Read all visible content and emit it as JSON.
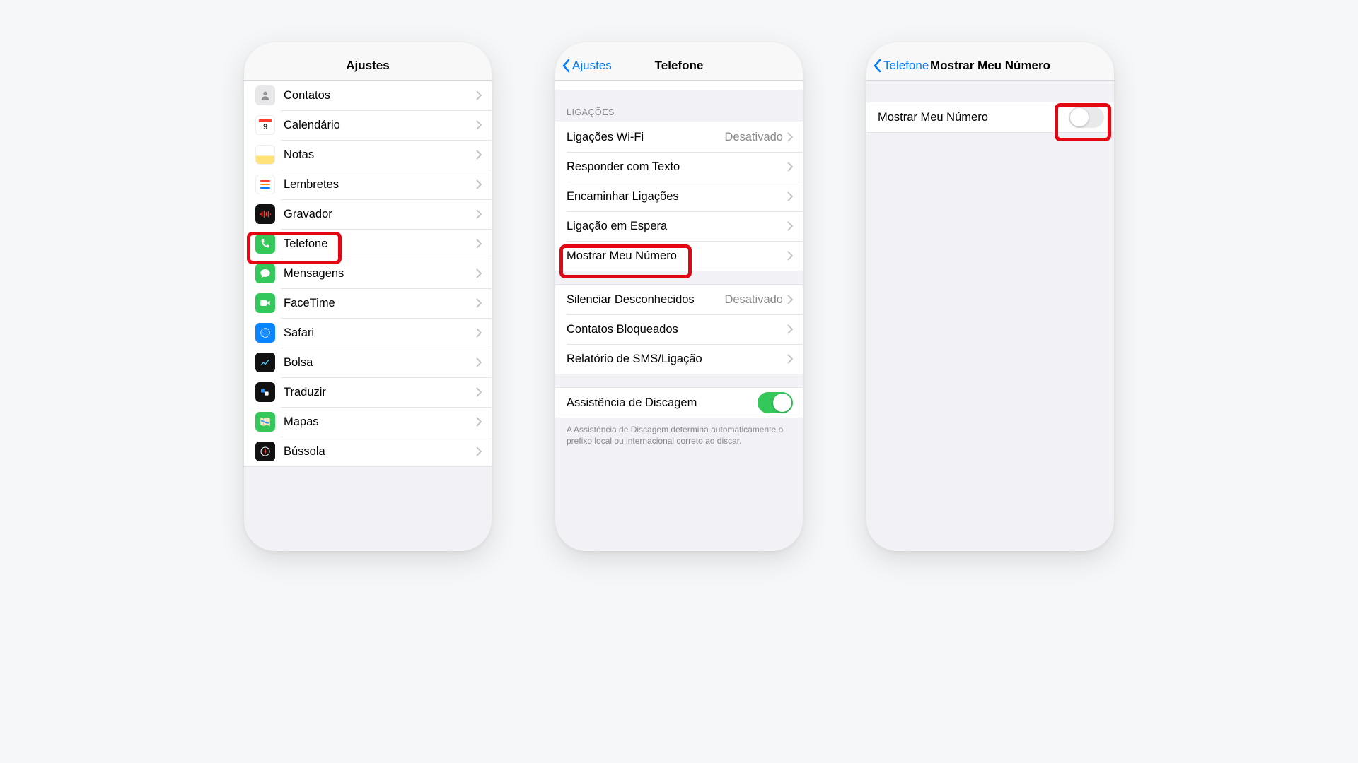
{
  "screens": {
    "settings": {
      "title": "Ajustes",
      "items": [
        {
          "label": "Contatos"
        },
        {
          "label": "Calendário"
        },
        {
          "label": "Notas"
        },
        {
          "label": "Lembretes"
        },
        {
          "label": "Gravador"
        },
        {
          "label": "Telefone"
        },
        {
          "label": "Mensagens"
        },
        {
          "label": "FaceTime"
        },
        {
          "label": "Safari"
        },
        {
          "label": "Bolsa"
        },
        {
          "label": "Traduzir"
        },
        {
          "label": "Mapas"
        },
        {
          "label": "Bússola"
        }
      ]
    },
    "phone": {
      "back": "Ajustes",
      "title": "Telefone",
      "section_calls": "Ligações",
      "rows": {
        "wifi_calling": {
          "label": "Ligações Wi-Fi",
          "value": "Desativado"
        },
        "respond_text": {
          "label": "Responder com Texto"
        },
        "forward": {
          "label": "Encaminhar Ligações"
        },
        "waiting": {
          "label": "Ligação em Espera"
        },
        "show_id": {
          "label": "Mostrar Meu Número"
        },
        "silence": {
          "label": "Silenciar Desconhecidos",
          "value": "Desativado"
        },
        "blocked": {
          "label": "Contatos Bloqueados"
        },
        "report": {
          "label": "Relatório de SMS/Ligação"
        },
        "dial_assist": {
          "label": "Assistência de Discagem"
        }
      },
      "footer": "A Assistência de Discagem determina automaticamente o prefixo local ou internacional correto ao discar."
    },
    "showid": {
      "back": "Telefone",
      "title": "Mostrar Meu Número",
      "row": {
        "label": "Mostrar Meu Número"
      }
    }
  }
}
